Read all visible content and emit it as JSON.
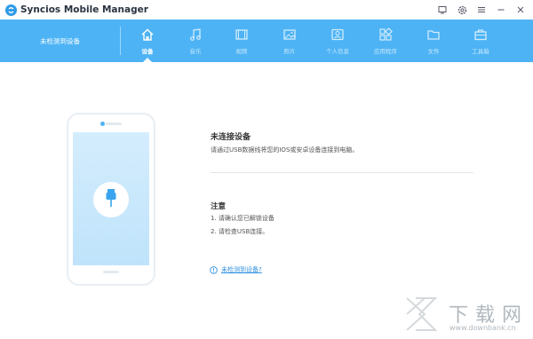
{
  "app": {
    "title": "Syncios Mobile Manager",
    "accent_color": "#4db3f5",
    "logo_icon": "syncios-logo"
  },
  "window_controls": [
    {
      "name": "message-icon"
    },
    {
      "name": "settings-icon"
    },
    {
      "name": "menu-icon"
    },
    {
      "name": "minimize-icon"
    },
    {
      "name": "close-icon"
    }
  ],
  "nav": {
    "device_status": "未检测到设备",
    "tabs": [
      {
        "label": "设备",
        "icon": "home-icon",
        "active": true
      },
      {
        "label": "音乐",
        "icon": "music-icon",
        "active": false
      },
      {
        "label": "视频",
        "icon": "video-icon",
        "active": false
      },
      {
        "label": "照片",
        "icon": "photo-icon",
        "active": false
      },
      {
        "label": "个人信息",
        "icon": "contact-icon",
        "active": false
      },
      {
        "label": "应用程序",
        "icon": "apps-icon",
        "active": false
      },
      {
        "label": "文件",
        "icon": "folder-icon",
        "active": false
      },
      {
        "label": "工具箱",
        "icon": "toolbox-icon",
        "active": false
      }
    ]
  },
  "main": {
    "title": "未连接设备",
    "description": "请通过USB数据线将您的IOS或安卓设备连接到电脑。",
    "notes_title": "注意",
    "notes": [
      "1. 请确认您已解锁设备",
      "2. 请检查USB连接。"
    ],
    "help_link": "未检测到设备?"
  },
  "watermark": {
    "text": "下载网",
    "sub": "www.downbank.cn"
  }
}
